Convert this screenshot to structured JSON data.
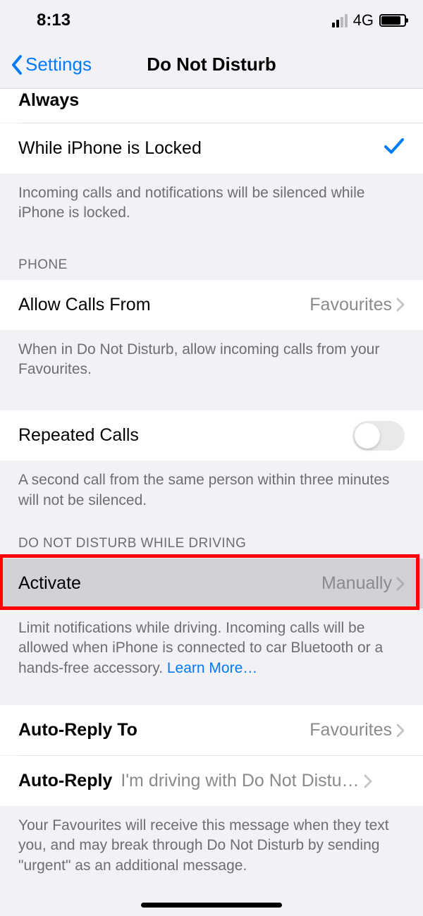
{
  "status": {
    "time": "8:13",
    "network": "4G"
  },
  "nav": {
    "back": "Settings",
    "title": "Do Not Disturb"
  },
  "rows": {
    "always": "Always",
    "while_locked": "While iPhone is Locked",
    "allow_calls": {
      "label": "Allow Calls From",
      "value": "Favourites"
    },
    "repeated_calls": "Repeated Calls",
    "activate": {
      "label": "Activate",
      "value": "Manually"
    },
    "auto_reply_to": {
      "label": "Auto-Reply To",
      "value": "Favourites"
    },
    "auto_reply": {
      "label": "Auto-Reply",
      "value": "I'm driving with Do Not Distu…"
    }
  },
  "footers": {
    "locked": "Incoming calls and notifications will be silenced while iPhone is locked.",
    "allow_calls": "When in Do Not Disturb, allow incoming calls from your Favourites.",
    "repeated": "A second call from the same person within three minutes will not be silenced.",
    "driving": "Limit notifications while driving. Incoming calls will be allowed when iPhone is connected to car Bluetooth or a hands-free accessory. ",
    "learn_more": "Learn More…",
    "auto_reply": "Your Favourites will receive this message when they text you, and may break through Do Not Disturb by sending \"urgent\" as an additional message."
  },
  "headers": {
    "phone": "PHONE",
    "driving": "DO NOT DISTURB WHILE DRIVING"
  }
}
